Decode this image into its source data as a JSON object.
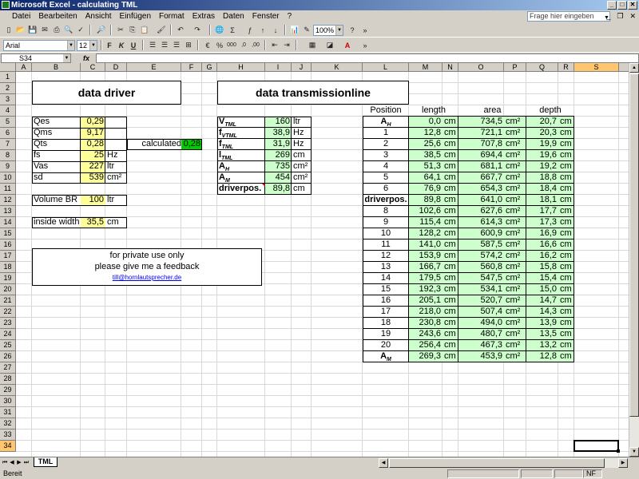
{
  "window": {
    "title": "Microsoft Excel - calculating TML"
  },
  "menu": {
    "items": [
      "Datei",
      "Bearbeiten",
      "Ansicht",
      "Einfügen",
      "Format",
      "Extras",
      "Daten",
      "Fenster",
      "?"
    ],
    "help_placeholder": "Frage hier eingeben"
  },
  "toolbar": {
    "zoom": "100%",
    "font": "Arial",
    "font_size": "12",
    "bold_label": "F",
    "italic_label": "K",
    "underline_label": "U",
    "currency_label": "€",
    "percent_label": "%",
    "thousands_label": "000",
    "inc_decimal_label": ",0",
    "dec_decimal_label": ",00",
    "sigma_label": "Σ"
  },
  "formula_bar": {
    "name_box": "S34",
    "fx_label": "fx",
    "formula": ""
  },
  "columns": [
    "A",
    "B",
    "C",
    "D",
    "E",
    "F",
    "G",
    "H",
    "I",
    "J",
    "K",
    "L",
    "M",
    "N",
    "O",
    "P",
    "Q",
    "R",
    "S",
    "T"
  ],
  "rows": [
    "1",
    "2",
    "3",
    "4",
    "5",
    "6",
    "7",
    "8",
    "9",
    "10",
    "11",
    "12",
    "13",
    "14",
    "15",
    "16",
    "17",
    "18",
    "19",
    "20",
    "21",
    "22",
    "23",
    "24",
    "25",
    "26",
    "27",
    "28",
    "29",
    "30",
    "31",
    "32",
    "33",
    "34"
  ],
  "driver": {
    "title": "data driver",
    "params": [
      {
        "label": "Qes",
        "value": "0,29",
        "unit": ""
      },
      {
        "label": "Qms",
        "value": "9,17",
        "unit": ""
      },
      {
        "label": "Qts",
        "value": "0,28",
        "unit": ""
      },
      {
        "label": "fs",
        "value": "25",
        "unit": "Hz"
      },
      {
        "label": "Vas",
        "value": "227",
        "unit": "ltr"
      },
      {
        "label": "sd",
        "value": "539",
        "unit": "cm²"
      }
    ],
    "calculated_label": "calculated",
    "calculated_value": "0,28",
    "volume_label": "Volume BR",
    "volume_value": "100",
    "volume_unit": "ltr",
    "width_label": "inside width",
    "width_value": "35,5",
    "width_unit": "cm"
  },
  "note": {
    "line1": "for private use only",
    "line2": "please give me a feedback",
    "email": "till@hornlautsprecher.de"
  },
  "tml": {
    "title": "data transmissionline",
    "params": [
      {
        "main": "V",
        "sub": "TML",
        "value": "160",
        "unit": "ltr"
      },
      {
        "main": "f",
        "sub": "VTML",
        "value": "38,9",
        "unit": "Hz"
      },
      {
        "main": "f",
        "sub": "TML",
        "value": "31,9",
        "unit": "Hz"
      },
      {
        "main": "l",
        "sub": "TML",
        "value": "269",
        "unit": "cm"
      },
      {
        "main": "A",
        "sub": "H",
        "value": "735",
        "unit": "cm²"
      },
      {
        "main": "A",
        "sub": "M",
        "value": "454",
        "unit": "cm²"
      },
      {
        "main": "driverpos.",
        "sub": "",
        "value": "89,8",
        "unit": "cm"
      }
    ],
    "table_headers": [
      "Position",
      "length",
      "area",
      "depth"
    ],
    "table": [
      {
        "pos": "A",
        "sub": "H",
        "bold": true,
        "length": "0,0",
        "area": "734,5",
        "depth": "20,7"
      },
      {
        "pos": "1",
        "sub": "",
        "bold": false,
        "length": "12,8",
        "area": "721,1",
        "depth": "20,3"
      },
      {
        "pos": "2",
        "sub": "",
        "bold": false,
        "length": "25,6",
        "area": "707,8",
        "depth": "19,9"
      },
      {
        "pos": "3",
        "sub": "",
        "bold": false,
        "length": "38,5",
        "area": "694,4",
        "depth": "19,6"
      },
      {
        "pos": "4",
        "sub": "",
        "bold": false,
        "length": "51,3",
        "area": "681,1",
        "depth": "19,2"
      },
      {
        "pos": "5",
        "sub": "",
        "bold": false,
        "length": "64,1",
        "area": "667,7",
        "depth": "18,8"
      },
      {
        "pos": "6",
        "sub": "",
        "bold": false,
        "length": "76,9",
        "area": "654,3",
        "depth": "18,4"
      },
      {
        "pos": "driverpos.",
        "sub": "",
        "bold": true,
        "length": "89,8",
        "area": "641,0",
        "depth": "18,1"
      },
      {
        "pos": "8",
        "sub": "",
        "bold": false,
        "length": "102,6",
        "area": "627,6",
        "depth": "17,7"
      },
      {
        "pos": "9",
        "sub": "",
        "bold": false,
        "length": "115,4",
        "area": "614,3",
        "depth": "17,3"
      },
      {
        "pos": "10",
        "sub": "",
        "bold": false,
        "length": "128,2",
        "area": "600,9",
        "depth": "16,9"
      },
      {
        "pos": "11",
        "sub": "",
        "bold": false,
        "length": "141,0",
        "area": "587,5",
        "depth": "16,6"
      },
      {
        "pos": "12",
        "sub": "",
        "bold": false,
        "length": "153,9",
        "area": "574,2",
        "depth": "16,2"
      },
      {
        "pos": "13",
        "sub": "",
        "bold": false,
        "length": "166,7",
        "area": "560,8",
        "depth": "15,8"
      },
      {
        "pos": "14",
        "sub": "",
        "bold": false,
        "length": "179,5",
        "area": "547,5",
        "depth": "15,4"
      },
      {
        "pos": "15",
        "sub": "",
        "bold": false,
        "length": "192,3",
        "area": "534,1",
        "depth": "15,0"
      },
      {
        "pos": "16",
        "sub": "",
        "bold": false,
        "length": "205,1",
        "area": "520,7",
        "depth": "14,7"
      },
      {
        "pos": "17",
        "sub": "",
        "bold": false,
        "length": "218,0",
        "area": "507,4",
        "depth": "14,3"
      },
      {
        "pos": "18",
        "sub": "",
        "bold": false,
        "length": "230,8",
        "area": "494,0",
        "depth": "13,9"
      },
      {
        "pos": "19",
        "sub": "",
        "bold": false,
        "length": "243,6",
        "area": "480,7",
        "depth": "13,5"
      },
      {
        "pos": "20",
        "sub": "",
        "bold": false,
        "length": "256,4",
        "area": "467,3",
        "depth": "13,2"
      },
      {
        "pos": "A",
        "sub": "M",
        "bold": true,
        "length": "269,3",
        "area": "453,9",
        "depth": "12,8"
      }
    ],
    "units": {
      "length": "cm",
      "area": "cm²",
      "depth": "cm"
    }
  },
  "sheet_tab": "TML",
  "status": {
    "left": "Bereit",
    "right": "NF"
  },
  "colors": {
    "yellow": "#ffff99",
    "green_light": "#ccffcc",
    "green_calc": "#00cc00",
    "title_start": "#0a246a",
    "title_end": "#a6caf0"
  }
}
